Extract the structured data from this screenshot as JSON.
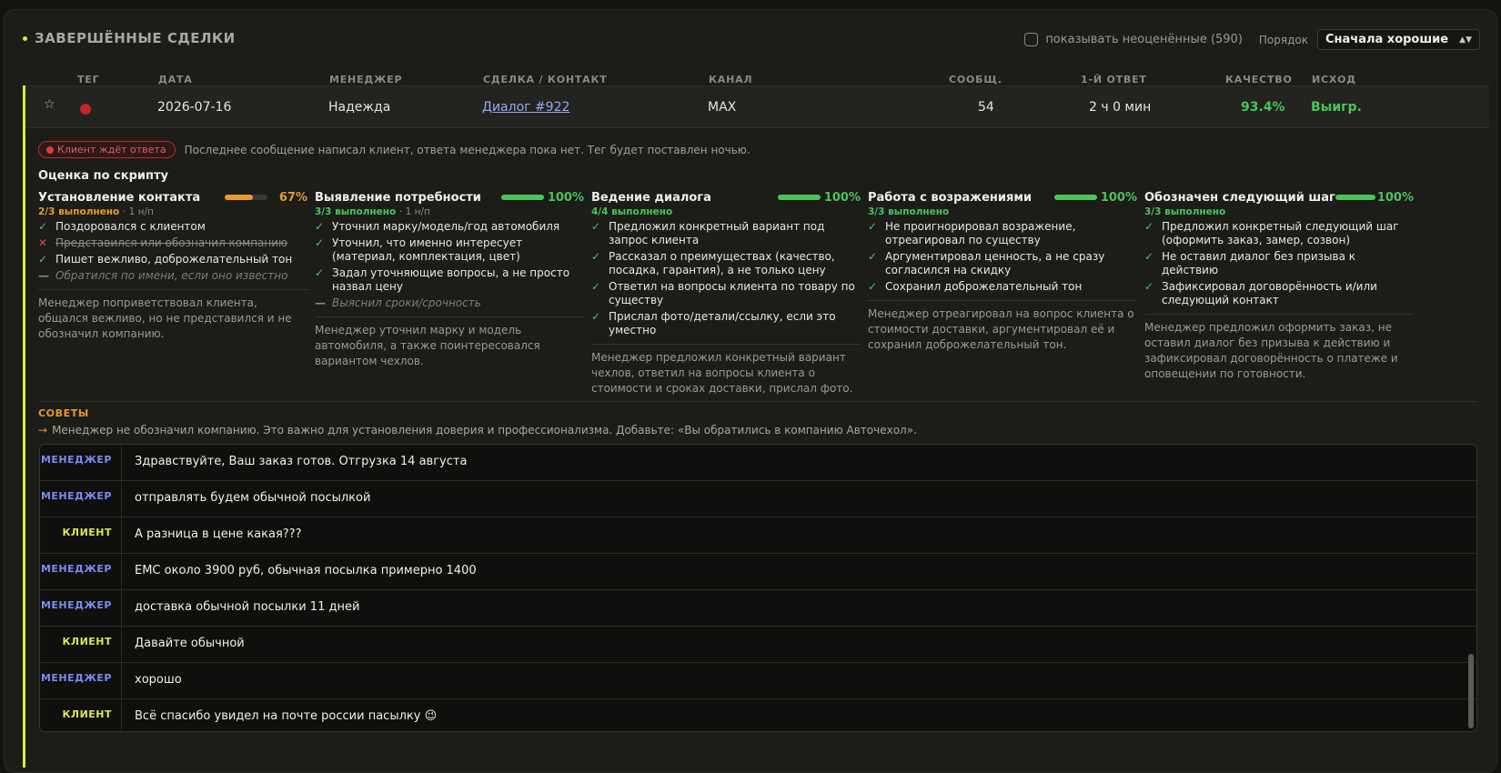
{
  "header": {
    "title": "ЗАВЕРШЁННЫЕ СДЕЛКИ",
    "show_unrated_label": "показывать неоценённые (590)",
    "order_label": "Порядок",
    "order_value": "Сначала хорошие"
  },
  "columns": [
    "ТЕГ",
    "ДАТА",
    "МЕНЕДЖЕР",
    "СДЕЛКА / КОНТАКТ",
    "КАНАЛ",
    "СООБЩ.",
    "1-Й ОТВЕТ",
    "КАЧЕСТВО",
    "ИСХОД"
  ],
  "row": {
    "date": "2026-07-16",
    "manager": "Надежда",
    "deal": "Диалог #922",
    "channel": "MAX",
    "messages": "54",
    "first_reply": "2 ч 0 мин",
    "quality": "93.4%",
    "outcome": "Выигр.",
    "tag_color": "#c0272d"
  },
  "status": {
    "badge": "Клиент ждёт ответа",
    "note": "Последнее сообщение написал клиент, ответа менеджера пока нет. Тег будет поставлен ночью."
  },
  "script": {
    "title": "Оценка по скрипту",
    "criteria": [
      {
        "name": "Установление контакта",
        "percent_label": "67%",
        "fill": 0.67,
        "color": "#e89a2a",
        "done": "2/3 выполнено",
        "na": "· 1 н/п",
        "items": [
          {
            "mark": "ok",
            "text": "Поздоровался с клиентом"
          },
          {
            "mark": "bad",
            "text": "Представился или обозначил компанию"
          },
          {
            "mark": "ok",
            "text": "Пишет вежливо, доброжелательный тон"
          },
          {
            "mark": "skip",
            "text": "Обратился по имени, если оно известно"
          }
        ],
        "summary": "Менеджер поприветствовал клиента, общался вежливо, но не представился и не обозначил компанию."
      },
      {
        "name": "Выявление потребности",
        "percent_label": "100%",
        "fill": 1.0,
        "color": "#4ac35a",
        "done": "3/3 выполнено",
        "na": "· 1 н/п",
        "items": [
          {
            "mark": "ok",
            "text": "Уточнил марку/модель/год автомобиля"
          },
          {
            "mark": "ok",
            "text": "Уточнил, что именно интересует (материал, комплектация, цвет)"
          },
          {
            "mark": "ok",
            "text": "Задал уточняющие вопросы, а не просто назвал цену"
          },
          {
            "mark": "skip",
            "text": "Выяснил сроки/срочность"
          }
        ],
        "summary": "Менеджер уточнил марку и модель автомобиля, а также поинтересовался вариантом чехлов."
      },
      {
        "name": "Ведение диалога",
        "percent_label": "100%",
        "fill": 1.0,
        "color": "#4ac35a",
        "done": "4/4 выполнено",
        "na": "",
        "items": [
          {
            "mark": "ok",
            "text": "Предложил конкретный вариант под запрос клиента"
          },
          {
            "mark": "ok",
            "text": "Рассказал о преимуществах (качество, посадка, гарантия), а не только цену"
          },
          {
            "mark": "ok",
            "text": "Ответил на вопросы клиента по товару по существу"
          },
          {
            "mark": "ok",
            "text": "Прислал фото/детали/ссылку, если это уместно"
          }
        ],
        "summary": "Менеджер предложил конкретный вариант чехлов, ответил на вопросы клиента о стоимости и сроках доставки, прислал фото."
      },
      {
        "name": "Работа с возражениями",
        "percent_label": "100%",
        "fill": 1.0,
        "color": "#4ac35a",
        "done": "3/3 выполнено",
        "na": "",
        "items": [
          {
            "mark": "ok",
            "text": "Не проигнорировал возражение, отреагировал по существу"
          },
          {
            "mark": "ok",
            "text": "Аргументировал ценность, а не сразу согласился на скидку"
          },
          {
            "mark": "ok",
            "text": "Сохранил доброжелательный тон"
          }
        ],
        "summary": "Менеджер отреагировал на вопрос клиента о стоимости доставки, аргументировал её и сохранил доброжелательный тон."
      },
      {
        "name": "Обозначен следующий шаг",
        "percent_label": "100%",
        "fill": 1.0,
        "color": "#4ac35a",
        "done": "3/3 выполнено",
        "na": "",
        "items": [
          {
            "mark": "ok",
            "text": "Предложил конкретный следующий шаг (оформить заказ, замер, созвон)"
          },
          {
            "mark": "ok",
            "text": "Не оставил диалог без призыва к действию"
          },
          {
            "mark": "ok",
            "text": "Зафиксировал договорённость и/или следующий контакт"
          }
        ],
        "summary": "Менеджер предложил оформить заказ, не оставил диалог без призыва к действию и зафиксировал договорённость о платеже и оповещении по готовности."
      }
    ]
  },
  "tips": {
    "title": "СОВЕТЫ",
    "text": "Менеджер не обозначил компанию. Это важно для установления доверия и профессионализма. Добавьте: «Вы обратились в компанию Авточехол»."
  },
  "chat": [
    {
      "role": "mgr",
      "who": "МЕНЕДЖЕР",
      "text": "Здравствуйте, Ваш заказ готов. Отгрузка 14 августа"
    },
    {
      "role": "mgr",
      "who": "МЕНЕДЖЕР",
      "text": "отправлять будем обычной посылкой"
    },
    {
      "role": "cli",
      "who": "КЛИЕНТ",
      "text": "А разница в цене какая???"
    },
    {
      "role": "mgr",
      "who": "МЕНЕДЖЕР",
      "text": "EMC около 3900 руб, обычная посылка примерно 1400"
    },
    {
      "role": "mgr",
      "who": "МЕНЕДЖЕР",
      "text": "доставка обычной посылки 11 дней"
    },
    {
      "role": "cli",
      "who": "КЛИЕНТ",
      "text": "Давайте обычной"
    },
    {
      "role": "mgr",
      "who": "МЕНЕДЖЕР",
      "text": "хорошо"
    },
    {
      "role": "cli",
      "who": "КЛИЕНТ",
      "text": "Всё спасибо увидел на почте россии пасылку 😉"
    }
  ]
}
